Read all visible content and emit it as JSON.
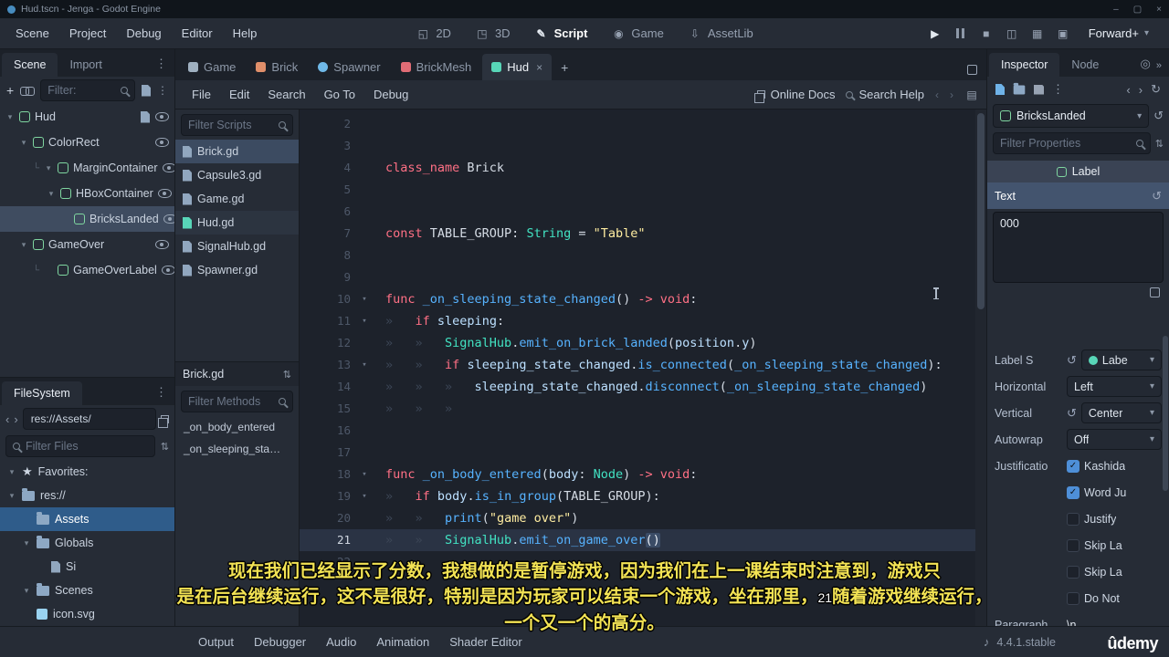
{
  "titlebar": {
    "title": "Hud.tscn - Jenga - Godot Engine",
    "controls": [
      "–",
      "▢",
      "×"
    ]
  },
  "menubar": {
    "menus": [
      "Scene",
      "Project",
      "Debug",
      "Editor",
      "Help"
    ],
    "workspaces": [
      {
        "label": "2D",
        "active": false
      },
      {
        "label": "3D",
        "active": false
      },
      {
        "label": "Script",
        "active": true
      },
      {
        "label": "Game",
        "active": false
      },
      {
        "label": "AssetLib",
        "active": false
      }
    ],
    "renderer": "Forward+"
  },
  "scene_dock": {
    "tabs": [
      {
        "label": "Scene",
        "active": true
      },
      {
        "label": "Import",
        "active": false
      }
    ],
    "filter_placeholder": "Filter:",
    "tree": [
      {
        "label": "Hud",
        "depth": 0,
        "arrow": true,
        "right": [
          "script",
          "eye"
        ],
        "selected": false
      },
      {
        "label": "ColorRect",
        "depth": 1,
        "arrow": true,
        "right": [
          "eye"
        ],
        "selected": false
      },
      {
        "label": "MarginContainer",
        "depth": 2,
        "arrow": true,
        "conn": true,
        "right": [
          "eye"
        ],
        "selected": false
      },
      {
        "label": "HBoxContainer",
        "depth": 3,
        "arrow": true,
        "right": [
          "eye"
        ],
        "selected": false
      },
      {
        "label": "BricksLanded",
        "depth": 4,
        "arrow": false,
        "right": [
          "eye"
        ],
        "selected": true
      },
      {
        "label": "GameOver",
        "depth": 1,
        "arrow": true,
        "right": [
          "eye"
        ],
        "selected": false
      },
      {
        "label": "GameOverLabel",
        "depth": 2,
        "arrow": false,
        "conn": true,
        "right": [
          "eye"
        ],
        "selected": false
      }
    ]
  },
  "filesystem": {
    "tab": "FileSystem",
    "path": "res://Assets/",
    "filter_placeholder": "Filter Files",
    "tree": [
      {
        "label": "Favorites:",
        "icon": "star",
        "depth": 0,
        "arrow": true,
        "selected": false
      },
      {
        "label": "res://",
        "icon": "folder",
        "depth": 0,
        "arrow": true,
        "selected": false
      },
      {
        "label": "Assets",
        "icon": "folder",
        "depth": 1,
        "arrow": false,
        "selected": true
      },
      {
        "label": "Globals",
        "icon": "folder",
        "depth": 1,
        "arrow": true,
        "selected": false
      },
      {
        "label": "Si",
        "icon": "script",
        "depth": 2,
        "arrow": false,
        "selected": false
      },
      {
        "label": "Scenes",
        "icon": "folder",
        "depth": 1,
        "arrow": true,
        "selected": false
      },
      {
        "label": "icon.svg",
        "icon": "image",
        "depth": 1,
        "arrow": false,
        "selected": false
      }
    ]
  },
  "scene_tabs": [
    {
      "label": "Game",
      "color": "#9fb0c0",
      "shape": "square",
      "active": false,
      "closable": false
    },
    {
      "label": "Brick",
      "color": "#e08f6a",
      "shape": "square",
      "active": false,
      "closable": false
    },
    {
      "label": "Spawner",
      "color": "#6fb9e8",
      "shape": "round",
      "active": false,
      "closable": false
    },
    {
      "label": "BrickMesh",
      "color": "#e06c75",
      "shape": "square",
      "active": false,
      "closable": false
    },
    {
      "label": "Hud",
      "color": "#58d6b8",
      "shape": "square",
      "active": true,
      "closable": true
    }
  ],
  "script_editor": {
    "menus": [
      "File",
      "Edit",
      "Search",
      "Go To",
      "Debug"
    ],
    "online_docs": "Online Docs",
    "search_help": "Search Help",
    "filter_scripts_placeholder": "Filter Scripts",
    "scripts": [
      {
        "label": "Brick.gd",
        "selected": true,
        "open": false,
        "icon_color": "#91a7bf"
      },
      {
        "label": "Capsule3.gd",
        "selected": false,
        "open": false,
        "icon_color": "#91a7bf"
      },
      {
        "label": "Game.gd",
        "selected": false,
        "open": false,
        "icon_color": "#91a7bf"
      },
      {
        "label": "Hud.gd",
        "selected": false,
        "open": true,
        "icon_color": "#58d6b8"
      },
      {
        "label": "SignalHub.gd",
        "selected": false,
        "open": false,
        "icon_color": "#91a7bf"
      },
      {
        "label": "Spawner.gd",
        "selected": false,
        "open": false,
        "icon_color": "#91a7bf"
      }
    ],
    "current_script": "Brick.gd",
    "filter_methods_placeholder": "Filter Methods",
    "methods": [
      "_on_body_entered",
      "_on_sleeping_sta…"
    ],
    "code": {
      "lines": [
        {
          "n": 2,
          "toks": []
        },
        {
          "n": 3,
          "toks": []
        },
        {
          "n": 4,
          "toks": [
            [
              "kw",
              "class_name"
            ],
            [
              "tx",
              " Brick"
            ]
          ]
        },
        {
          "n": 5,
          "toks": []
        },
        {
          "n": 6,
          "toks": []
        },
        {
          "n": 7,
          "toks": [
            [
              "kw",
              "const"
            ],
            [
              "tx",
              " TABLE_GROUP: "
            ],
            [
              "ty",
              "String"
            ],
            [
              "tx",
              " = "
            ],
            [
              "st",
              "\"Table\""
            ]
          ]
        },
        {
          "n": 8,
          "toks": []
        },
        {
          "n": 9,
          "toks": []
        },
        {
          "n": 10,
          "fold": true,
          "toks": [
            [
              "kw",
              "func"
            ],
            [
              "fn",
              " _on_sleeping_state_changed"
            ],
            [
              "tx",
              "() "
            ],
            [
              "kw",
              "-> void"
            ],
            [
              "tx",
              ":"
            ]
          ]
        },
        {
          "n": 11,
          "fold": true,
          "toks": [
            [
              "tb",
              1
            ],
            [
              "kw",
              "if"
            ],
            [
              "tx",
              " "
            ],
            [
              "mb",
              "sleeping"
            ],
            [
              "tx",
              ":"
            ]
          ]
        },
        {
          "n": 12,
          "toks": [
            [
              "tb",
              2
            ],
            [
              "ty",
              "SignalHub"
            ],
            [
              "tx",
              "."
            ],
            [
              "fn",
              "emit_on_brick_landed"
            ],
            [
              "tx",
              "("
            ],
            [
              "mb",
              "position"
            ],
            [
              "tx",
              "."
            ],
            [
              "mb",
              "y"
            ],
            [
              "tx",
              ")"
            ]
          ]
        },
        {
          "n": 13,
          "fold": true,
          "toks": [
            [
              "tb",
              2
            ],
            [
              "kw",
              "if"
            ],
            [
              "tx",
              " "
            ],
            [
              "mb",
              "sleeping_state_changed"
            ],
            [
              "tx",
              "."
            ],
            [
              "fn",
              "is_connected"
            ],
            [
              "tx",
              "("
            ],
            [
              "fn",
              "_on_sleeping_state_changed"
            ],
            [
              "tx",
              "):"
            ]
          ]
        },
        {
          "n": 14,
          "toks": [
            [
              "tb",
              3
            ],
            [
              "mb",
              "sleeping_state_changed"
            ],
            [
              "tx",
              "."
            ],
            [
              "fn",
              "disconnect"
            ],
            [
              "tx",
              "("
            ],
            [
              "fn",
              "_on_sleeping_state_changed"
            ],
            [
              "tx",
              ")"
            ]
          ]
        },
        {
          "n": 15,
          "toks": [
            [
              "tb",
              3
            ]
          ]
        },
        {
          "n": 16,
          "toks": []
        },
        {
          "n": 17,
          "toks": []
        },
        {
          "n": 18,
          "fold": true,
          "toks": [
            [
              "kw",
              "func"
            ],
            [
              "fn",
              " _on_body_entered"
            ],
            [
              "tx",
              "("
            ],
            [
              "mb",
              "body"
            ],
            [
              "tx",
              ": "
            ],
            [
              "ty",
              "Node"
            ],
            [
              "tx",
              ") "
            ],
            [
              "kw",
              "-> void"
            ],
            [
              "tx",
              ":"
            ]
          ]
        },
        {
          "n": 19,
          "fold": true,
          "toks": [
            [
              "tb",
              1
            ],
            [
              "kw",
              "if"
            ],
            [
              "tx",
              " "
            ],
            [
              "mb",
              "body"
            ],
            [
              "tx",
              "."
            ],
            [
              "fn",
              "is_in_group"
            ],
            [
              "tx",
              "("
            ],
            [
              "tx",
              "TABLE_GROUP"
            ],
            [
              "tx",
              "):"
            ]
          ]
        },
        {
          "n": 20,
          "toks": [
            [
              "tb",
              2
            ],
            [
              "fn",
              "print"
            ],
            [
              "tx",
              "("
            ],
            [
              "st",
              "\"game over\""
            ],
            [
              "tx",
              ")"
            ]
          ]
        },
        {
          "n": 21,
          "cur": true,
          "toks": [
            [
              "tb",
              2
            ],
            [
              "ty",
              "SignalHub"
            ],
            [
              "tx",
              "."
            ],
            [
              "fn",
              "emit_on_game_over"
            ],
            [
              "sel",
              "()"
            ]
          ]
        },
        {
          "n": 22,
          "toks": []
        }
      ]
    }
  },
  "inspector": {
    "tabs": [
      {
        "label": "Inspector",
        "active": true
      },
      {
        "label": "Node",
        "active": false
      }
    ],
    "node_name": "BricksLanded",
    "filter_placeholder": "Filter Properties",
    "category": "Label",
    "text_label": "Text",
    "text_value": "000",
    "rows": [
      {
        "label": "Label S",
        "revert": true,
        "type": "resource",
        "value": "Labe"
      },
      {
        "label": "Horizontal",
        "revert": false,
        "type": "dropdown",
        "value": "Left"
      },
      {
        "label": "Vertical",
        "revert": true,
        "type": "dropdown",
        "value": "Center"
      },
      {
        "label": "Autowrap",
        "revert": false,
        "type": "dropdown",
        "value": "Off"
      },
      {
        "label": "Justificatio",
        "type": "check",
        "value": "Kashida",
        "checked": true
      },
      {
        "label": "",
        "type": "check",
        "value": "Word Ju",
        "checked": true
      },
      {
        "label": "",
        "type": "check",
        "value": "Justify",
        "checked": false
      },
      {
        "label": "",
        "type": "check",
        "value": "Skip La",
        "checked": false
      },
      {
        "label": "",
        "type": "check",
        "value": "Skip La",
        "checked": false
      },
      {
        "label": "",
        "type": "check",
        "value": "Do Not",
        "checked": false
      },
      {
        "label": "Paragraph",
        "type": "text",
        "value": "\\n"
      }
    ]
  },
  "bottom": {
    "panels": [
      "Output",
      "Debugger",
      "Audio",
      "Animation",
      "Shader Editor"
    ],
    "version": "4.4.1.stable",
    "brand": "ûdemy"
  },
  "subtitles": {
    "line1": "现在我们已经显示了分数，我想做的是暂停游戏，因为我们在上一课结束时注意到，游戏只",
    "line2a": "是在后台继续运行，这不是很好，特别是因为玩家可以结束一个游戏，坐在那里，",
    "line2b": "21",
    "line2c": "随着游戏继续运行，",
    "line3": "一个又一个的高分。"
  }
}
